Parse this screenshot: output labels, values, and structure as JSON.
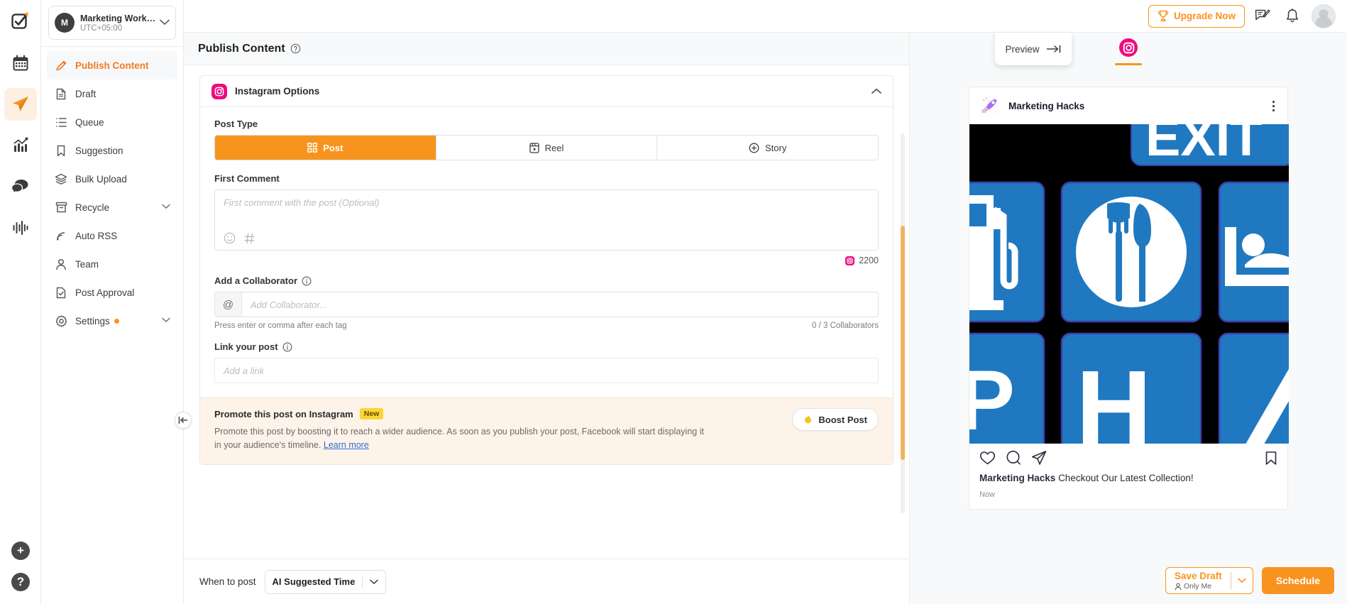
{
  "rail": {
    "items": [
      {
        "name": "logo",
        "icon": "checkbox-logo-icon"
      },
      {
        "name": "calendar",
        "icon": "calendar-icon"
      },
      {
        "name": "publish",
        "icon": "paper-plane-icon"
      },
      {
        "name": "analytics",
        "icon": "chart-bar-icon"
      },
      {
        "name": "inbox",
        "icon": "chat-bubbles-icon"
      },
      {
        "name": "reports",
        "icon": "audio-wave-icon"
      }
    ],
    "add_label": "+",
    "help_label": "?"
  },
  "workspace": {
    "avatar_initial": "M",
    "name": "Marketing Workspa...",
    "timezone": "UTC+05:00"
  },
  "sidebar": {
    "items": [
      {
        "label": "Publish Content",
        "icon": "pencil-icon",
        "active": true,
        "chevron": false
      },
      {
        "label": "Draft",
        "icon": "document-icon",
        "active": false,
        "chevron": false
      },
      {
        "label": "Queue",
        "icon": "list-icon",
        "active": false,
        "chevron": false
      },
      {
        "label": "Suggestion",
        "icon": "bookmark-icon",
        "active": false,
        "chevron": false
      },
      {
        "label": "Bulk Upload",
        "icon": "layers-icon",
        "active": false,
        "chevron": false
      },
      {
        "label": "Recycle",
        "icon": "archive-icon",
        "active": false,
        "chevron": true
      },
      {
        "label": "Auto RSS",
        "icon": "rss-icon",
        "active": false,
        "chevron": false
      },
      {
        "label": "Team",
        "icon": "person-icon",
        "active": false,
        "chevron": false
      },
      {
        "label": "Post Approval",
        "icon": "document-check-icon",
        "active": false,
        "chevron": false
      },
      {
        "label": "Settings",
        "icon": "gear-icon",
        "active": false,
        "chevron": true,
        "dot": true
      }
    ],
    "collapse_icon": "collapse-left-icon"
  },
  "topbar": {
    "upgrade_label": "Upgrade Now",
    "upgrade_icon": "trophy-icon",
    "compose_icon": "compose-icon",
    "bell_icon": "bell-icon",
    "avatar_icon": "user-avatar"
  },
  "page": {
    "title": "Publish Content",
    "help_icon": "question-circle-icon"
  },
  "preview_button": {
    "label": "Preview",
    "icon": "arrow-to-right-icon"
  },
  "instagram_options": {
    "header_label": "Instagram Options",
    "header_icon": "instagram-icon",
    "collapse_icon": "chevron-up-icon",
    "post_type": {
      "label": "Post Type",
      "options": [
        {
          "label": "Post",
          "icon": "grid-icon",
          "selected": true
        },
        {
          "label": "Reel",
          "icon": "reel-icon",
          "selected": false
        },
        {
          "label": "Story",
          "icon": "plus-circle-icon",
          "selected": false
        }
      ]
    },
    "first_comment": {
      "label": "First Comment",
      "placeholder": "First comment with the post (Optional)",
      "value": "",
      "emoji_icon": "emoji-icon",
      "hashtag_icon": "hashtag-icon",
      "counter": "2200",
      "counter_icon": "instagram-icon"
    },
    "collaborator": {
      "label": "Add a Collaborator",
      "info_icon": "info-circle-icon",
      "prefix": "@",
      "placeholder": "Add Collaborator...",
      "value": "",
      "hint": "Press enter or comma after each tag",
      "counter": "0 / 3 Collaborators"
    },
    "link_post": {
      "label": "Link your post",
      "info_icon": "info-circle-icon",
      "placeholder": "Add a link",
      "value": ""
    },
    "promote": {
      "title": "Promote this post on Instagram",
      "badge": "New",
      "body": "Promote this post by boosting it to reach a wider audience. As soon as you publish your post, Facebook will start displaying it in your audience's timeline.",
      "link_label": "Learn more",
      "button_label": "Boost Post",
      "button_icon": "flame-icon"
    }
  },
  "footer": {
    "when_label": "When to post",
    "when_value": "AI Suggested Time",
    "when_chevron_icon": "chevron-down-icon",
    "save_draft": {
      "main": "Save Draft",
      "sub": "Only Me",
      "sub_icon": "person-icon",
      "chevron_icon": "chevron-down-icon"
    },
    "schedule_label": "Schedule"
  },
  "preview": {
    "tab_icon": "instagram-icon",
    "post": {
      "username": "Marketing Hacks",
      "avatar_icon": "rocket-avatar",
      "menu_icon": "more-vertical-icon",
      "actions": [
        {
          "icon": "heart-icon",
          "name": "like-icon"
        },
        {
          "icon": "comment-icon",
          "name": "comment-icon"
        },
        {
          "icon": "share-icon",
          "name": "share-icon"
        }
      ],
      "bookmark_icon": "bookmark-icon",
      "caption_author": "Marketing Hacks",
      "caption_text": "Checkout Our Latest Collection!",
      "timestamp": "Now",
      "media_alt": "Highway service signs: gas, food, lodging, hospital"
    }
  },
  "colors": {
    "accent_orange": "#f7931e",
    "instagram_pink": "#ec0b83",
    "promo_bg": "#fdf3e9",
    "badge_yellow": "#fcd535",
    "sign_blue": "#2079c0"
  }
}
